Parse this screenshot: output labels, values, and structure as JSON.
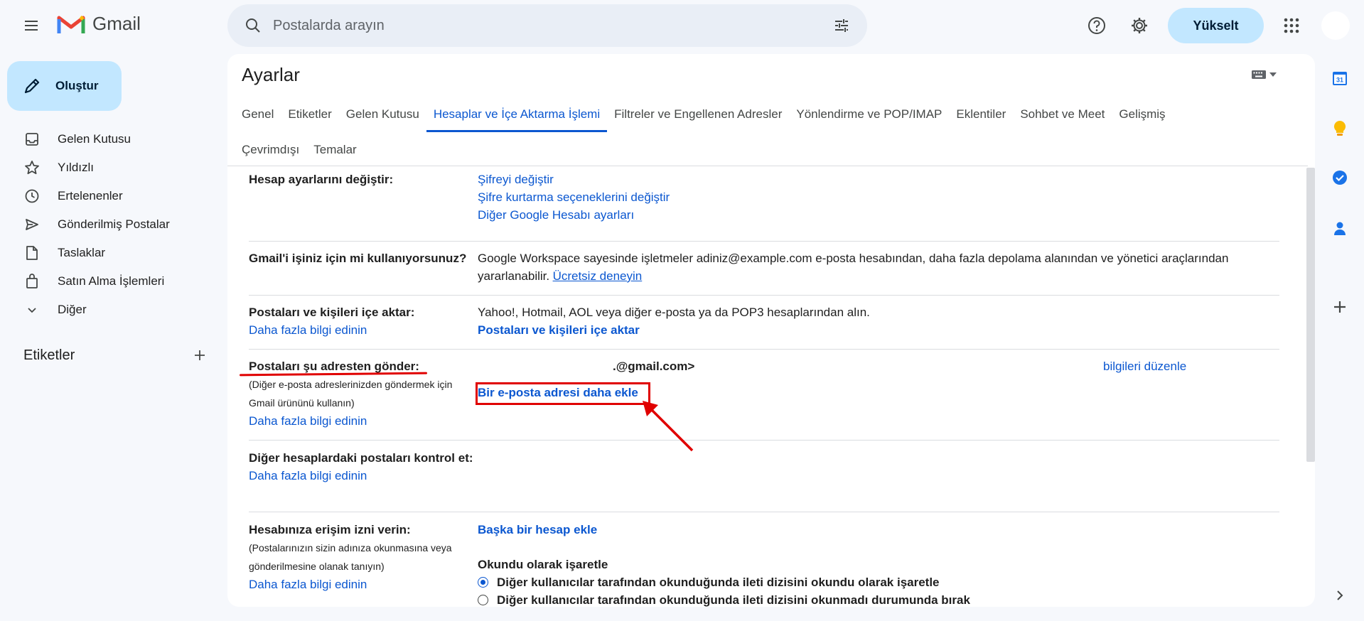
{
  "app": {
    "name": "Gmail",
    "search_placeholder": "Postalarda arayın",
    "upgrade_label": "Yükselt"
  },
  "sidebar": {
    "compose_label": "Oluştur",
    "items": [
      {
        "label": "Gelen Kutusu",
        "icon": "inbox-icon"
      },
      {
        "label": "Yıldızlı",
        "icon": "star-icon"
      },
      {
        "label": "Ertelenenler",
        "icon": "clock-icon"
      },
      {
        "label": "Gönderilmiş Postalar",
        "icon": "send-icon"
      },
      {
        "label": "Taslaklar",
        "icon": "draft-icon"
      },
      {
        "label": "Satın Alma İşlemleri",
        "icon": "bag-icon"
      },
      {
        "label": "Diğer",
        "icon": "chevron-down-icon"
      }
    ],
    "labels_title": "Etiketler"
  },
  "settings": {
    "title": "Ayarlar",
    "tabs_row1": [
      "Genel",
      "Etiketler",
      "Gelen Kutusu",
      "Hesaplar ve İçe Aktarma İşlemi",
      "Filtreler ve Engellenen Adresler",
      "Yönlendirme ve POP/IMAP",
      "Eklentiler",
      "Sohbet ve Meet",
      "Gelişmiş"
    ],
    "tabs_row2": [
      "Çevrimdışı",
      "Temalar"
    ],
    "active_tab": "Hesaplar ve İçe Aktarma İşlemi",
    "sections": {
      "account": {
        "label": "Hesap ayarlarını değiştir:",
        "links": [
          "Şifreyi değiştir",
          "Şifre kurtarma seçeneklerini değiştir",
          "Diğer Google Hesabı ayarları"
        ]
      },
      "workspace": {
        "label": "Gmail'i işiniz için mi kullanıyorsunuz?",
        "text": "Google Workspace sayesinde işletmeler adiniz@example.com e-posta hesabından, daha fazla depolama alanından ve yönetici araçlarından yararlanabilir.",
        "link": "Ücretsiz deneyin"
      },
      "import": {
        "label": "Postaları ve kişileri içe aktar:",
        "learn_more": "Daha fazla bilgi edinin",
        "text": "Yahoo!, Hotmail, AOL veya diğer e-posta ya da POP3 hesaplarından alın.",
        "action": "Postaları ve kişileri içe aktar"
      },
      "send_as": {
        "label": "Postaları şu adresten gönder:",
        "sub": "(Diğer e-posta adreslerinizden göndermek için Gmail ürününü kullanın)",
        "learn_more": "Daha fazla bilgi edinin",
        "address": ".@gmail.com>",
        "edit_link": "bilgileri düzenle",
        "add_link": "Bir e-posta adresi daha ekle"
      },
      "check_mail": {
        "label": "Diğer hesaplardaki postaları kontrol et:",
        "learn_more": "Daha fazla bilgi edinin"
      },
      "grant_access": {
        "label": "Hesabınıza erişim izni verin:",
        "sub": "(Postalarınızın sizin adınıza okunmasına veya gönderilmesine olanak tanıyın)",
        "learn_more": "Daha fazla bilgi edinin",
        "add_account": "Başka bir hesap ekle",
        "mark_read_title": "Okundu olarak işaretle",
        "option1": "Diğer kullanıcılar tarafından okunduğunda ileti dizisini okundu olarak işaretle",
        "option2": "Diğer kullanıcılar tarafından okunduğunda ileti dizisini okunmadı durumunda bırak"
      }
    }
  },
  "right_panel": {
    "calendar_day": "31"
  },
  "colors": {
    "accent": "#0b57d0",
    "annotation": "#e00000",
    "compose_bg": "#c2e7ff"
  }
}
